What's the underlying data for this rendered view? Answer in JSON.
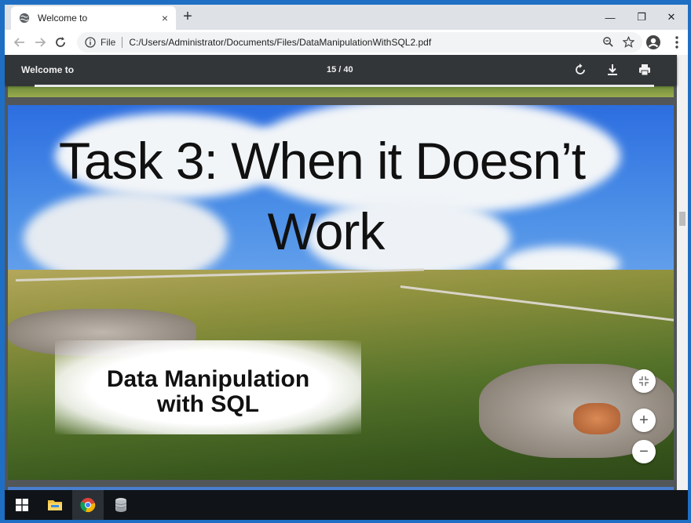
{
  "browser": {
    "tab": {
      "title": "Welcome to",
      "close_glyph": "×"
    },
    "new_tab_glyph": "+",
    "window_controls": {
      "minimize": "—",
      "restore": "❐",
      "close": "✕"
    },
    "address": {
      "scheme_label": "File",
      "url": "C:/Users/Administrator/Documents/Files/DataManipulationWithSQL2.pdf"
    }
  },
  "pdf_viewer": {
    "toolbar_title": "Welcome to",
    "page_indicator": "15 / 40",
    "tools": [
      "rotate-icon",
      "download-icon",
      "print-icon"
    ]
  },
  "slide": {
    "heading_line1": "Task 3: When it Doesn’t",
    "heading_line2": "Work",
    "subtitle_line1": "Data Manipulation",
    "subtitle_line2": "with SQL"
  },
  "zoom_controls": {
    "fit": "fit-to-page-icon",
    "zoom_in": "+",
    "zoom_out": "−"
  },
  "taskbar": {
    "items": [
      "windows-start-icon",
      "file-explorer-icon",
      "chrome-icon",
      "database-app-icon"
    ]
  },
  "colors": {
    "frame_blue": "#1e6fc4",
    "pdf_toolbar": "#323639",
    "viewer_bg": "#525659"
  }
}
